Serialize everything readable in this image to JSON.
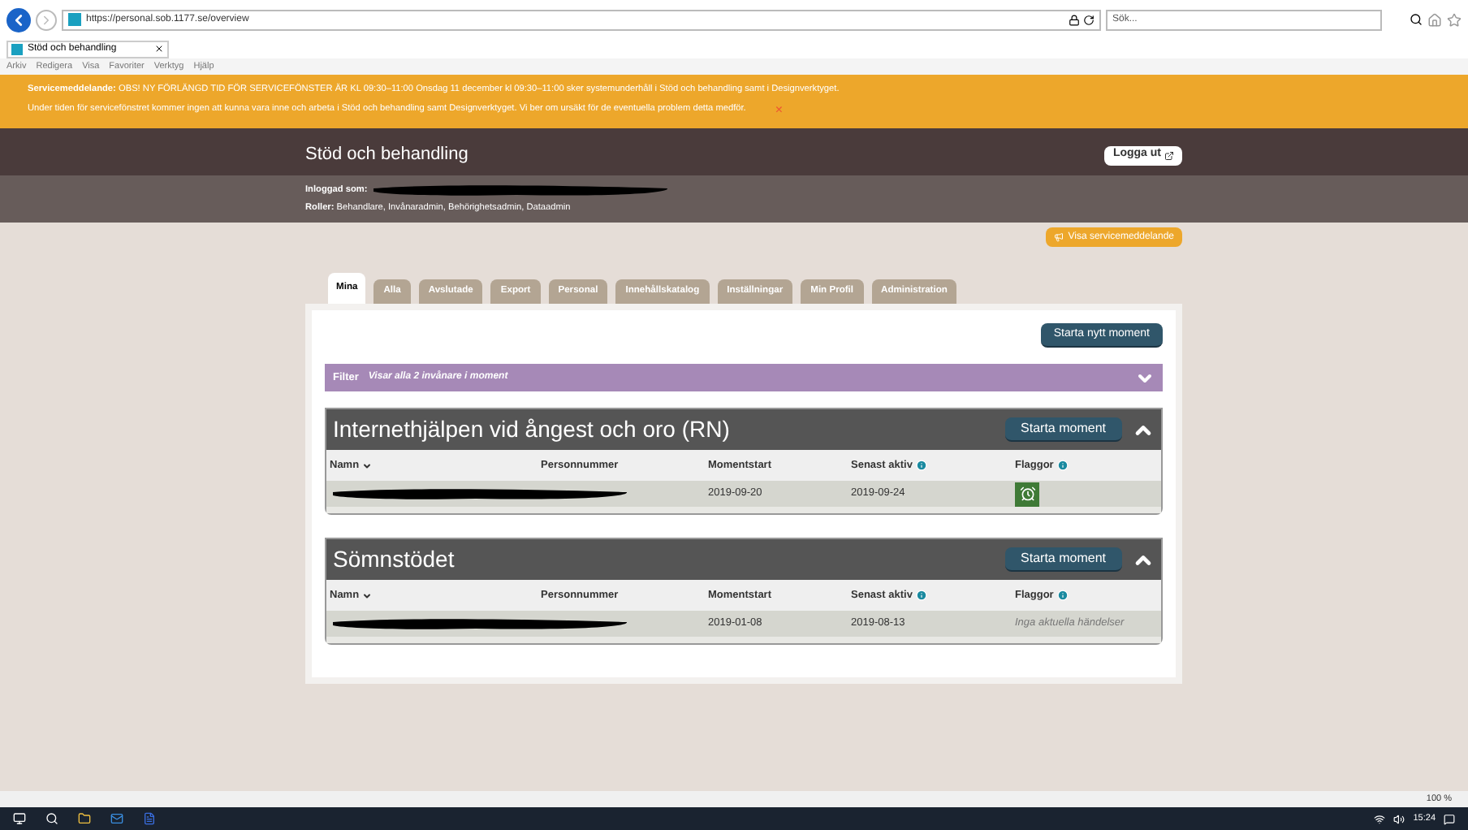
{
  "browser": {
    "url": "https://personal.sob.1177.se/overview",
    "search_placeholder": "Sök...",
    "tab_title": "Stöd och behandling",
    "menu": [
      "Arkiv",
      "Redigera",
      "Visa",
      "Favoriter",
      "Verktyg",
      "Hjälp"
    ],
    "zoom": "100 %"
  },
  "banner": {
    "label": "Servicemeddelande:",
    "line1": "OBS! NY FÖRLÄNGD TID FÖR SERVICEFÖNSTER ÄR KL 09:30–11:00 Onsdag 11 december kl 09:30–11:00 sker systemunderhåll i Stöd och behandling samt i Designverktyget.",
    "line2": "Under tiden för servicefönstret kommer ingen att kunna vara inne och arbeta i Stöd och behandling samt Designverktyget. Vi ber om ursäkt för de eventuella problem detta medför.",
    "close": "×"
  },
  "header": {
    "title": "Stöd och behandling",
    "logout": "Logga ut"
  },
  "user": {
    "logged_in_label": "Inloggad som:",
    "roles_label": "Roller:",
    "roles": "Behandlare, Invånaradmin, Behörighetsadmin, Dataadmin"
  },
  "service_button": "Visa servicemeddelande",
  "tabs": [
    {
      "label": "Mina",
      "selected": true
    },
    {
      "label": "Alla",
      "selected": false
    },
    {
      "label": "Avslutade",
      "selected": false
    },
    {
      "label": "Export",
      "selected": false
    },
    {
      "label": "Personal",
      "selected": false
    },
    {
      "label": "Innehållskatalog",
      "selected": false
    },
    {
      "label": "Inställningar",
      "selected": false
    },
    {
      "label": "Min Profil",
      "selected": false
    },
    {
      "label": "Administration",
      "selected": false
    }
  ],
  "new_button": "Starta nytt moment",
  "filter": {
    "label": "Filter",
    "summary": "Visar alla 2 invånare i moment",
    "expanded": false
  },
  "sections": [
    {
      "title": "Internethjälpen vid ångest och oro (RN)",
      "button": "Starta moment",
      "expanded": true,
      "columns": [
        "Namn",
        "Personnummer",
        "Momentstart",
        "Senast aktiv",
        "Flaggor"
      ],
      "rows": [
        {
          "start": "2019-09-20",
          "last_active": "2019-09-24",
          "flag": {
            "kind": "alarm"
          }
        }
      ]
    },
    {
      "title": "Sömnstödet",
      "button": "Starta moment",
      "expanded": true,
      "columns": [
        "Namn",
        "Personnummer",
        "Momentstart",
        "Senast aktiv",
        "Flaggor"
      ],
      "rows": [
        {
          "start": "2019-01-08",
          "last_active": "2019-08-13",
          "flag": {
            "kind": "text",
            "text": "Inga aktuella händelser"
          }
        }
      ]
    }
  ],
  "taskbar": {
    "time": "15:24"
  }
}
